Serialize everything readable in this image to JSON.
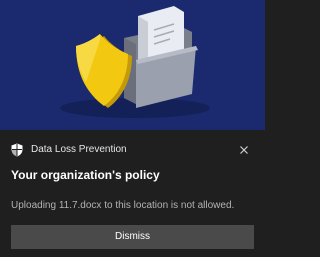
{
  "notification": {
    "app_name": "Data Loss Prevention",
    "title": "Your organization's policy",
    "message": "Uploading 11.7.docx to this location is not allowed.",
    "dismiss_label": "Dismiss"
  },
  "colors": {
    "hero_background": "#1b2a6e",
    "toast_background": "#1f1f1f",
    "shield_yellow": "#f2c811",
    "dismiss_button": "#4a4a4a"
  },
  "icons": {
    "app_icon": "shield-icon",
    "close": "close-icon",
    "hero_shield": "shield-illustration",
    "hero_folder": "folder-illustration",
    "hero_document": "document-illustration"
  }
}
